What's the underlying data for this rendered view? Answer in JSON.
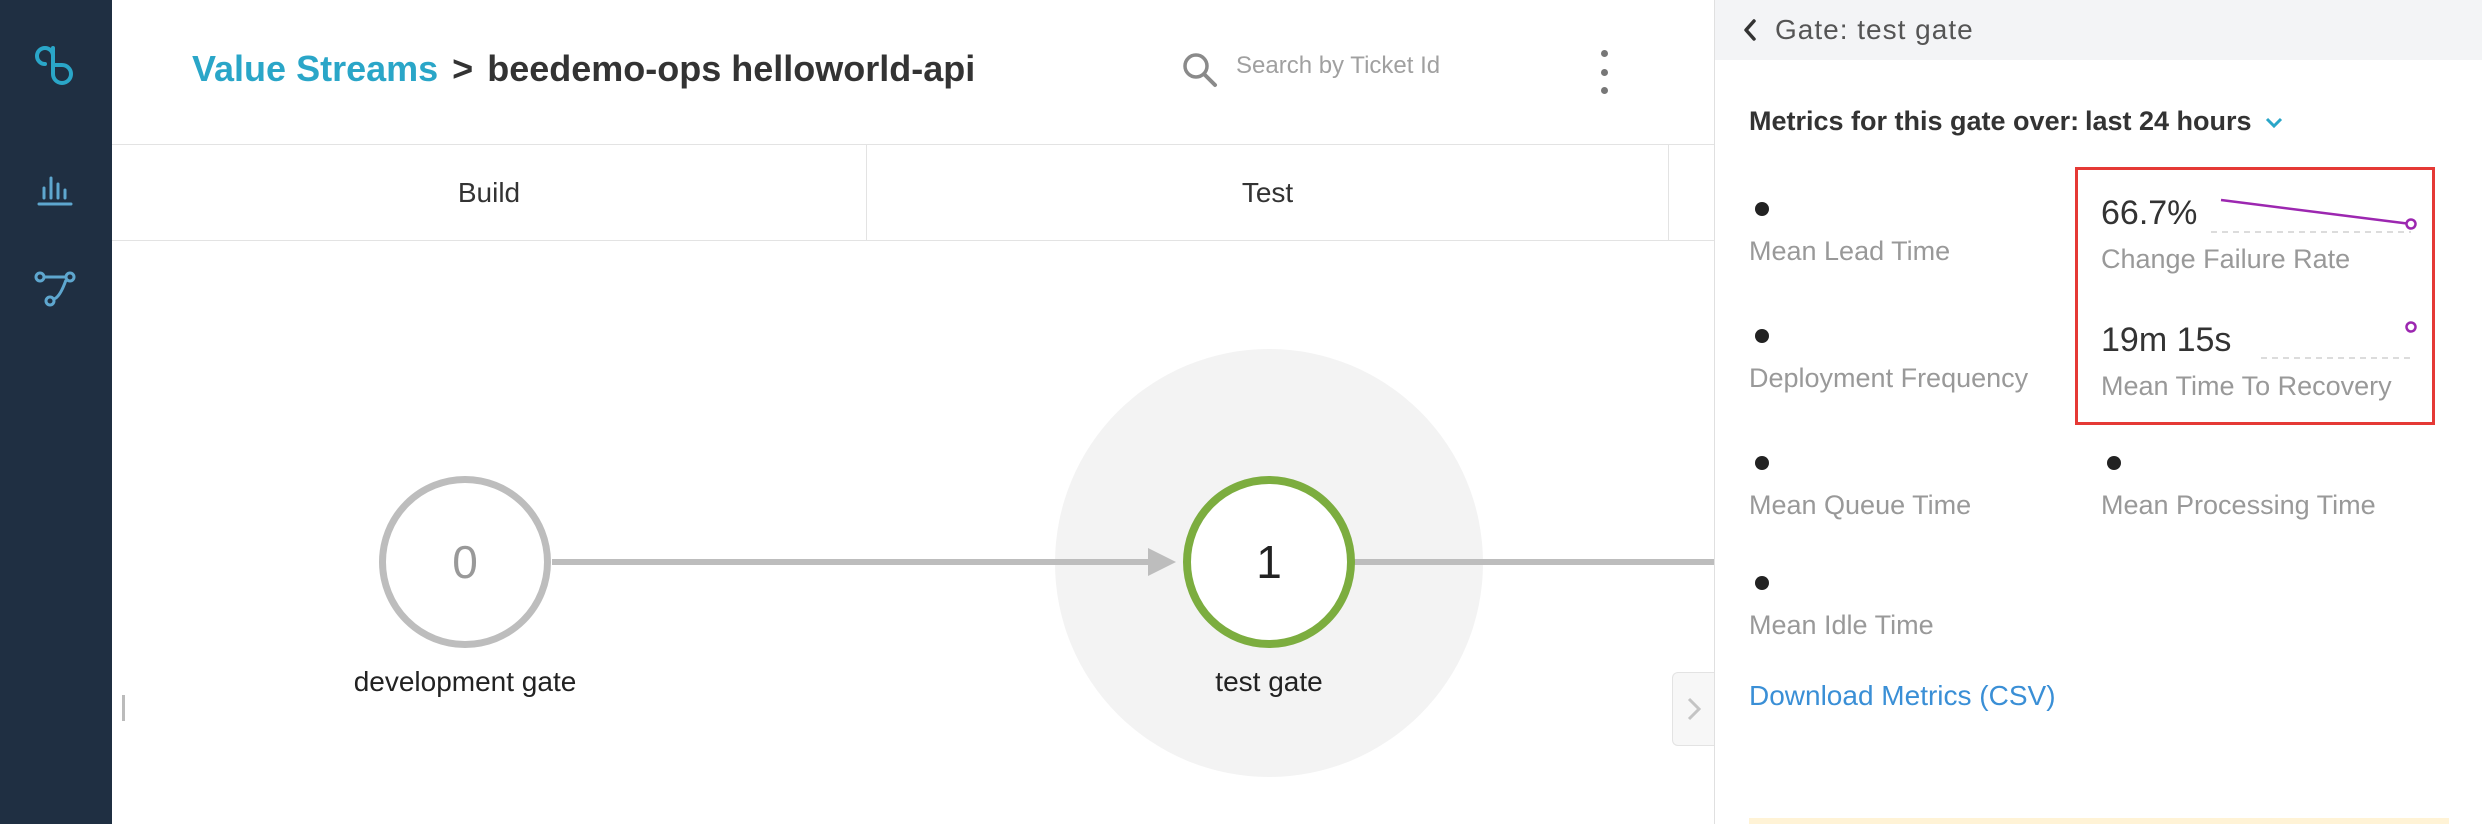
{
  "nav": {
    "items": [
      {
        "icon": "cloudbees-logo-icon"
      },
      {
        "icon": "bar-chart-icon"
      },
      {
        "icon": "value-stream-icon"
      }
    ]
  },
  "header": {
    "breadcrumb_root": "Value Streams",
    "breadcrumb_separator": ">",
    "breadcrumb_current": "beedemo-ops helloworld-api",
    "search_placeholder": "Search by Ticket Id"
  },
  "stages": [
    {
      "label": "Build"
    },
    {
      "label": "Test"
    }
  ],
  "gates": [
    {
      "count": "0",
      "label": "development gate",
      "status_color": "#bdbdbd"
    },
    {
      "count": "1",
      "label": "test gate",
      "status_color": "#7cad3f"
    }
  ],
  "panel": {
    "title": "Gate: test gate",
    "metrics_label": "Metrics for this gate over:",
    "time_range": "last 24 hours",
    "metrics": {
      "mean_lead_time": {
        "label": "Mean Lead Time"
      },
      "change_failure_rate": {
        "label": "Change Failure Rate",
        "value": "66.7%"
      },
      "deployment_frequency": {
        "label": "Deployment Frequency"
      },
      "mean_time_to_recovery": {
        "label": "Mean Time To Recovery",
        "value": "19m 15s"
      },
      "mean_queue_time": {
        "label": "Mean Queue Time"
      },
      "mean_processing_time": {
        "label": "Mean Processing Time"
      },
      "mean_idle_time": {
        "label": "Mean Idle Time"
      }
    },
    "download_label": "Download Metrics (CSV)"
  },
  "colors": {
    "rail": "#1f2f42",
    "accent": "#2aa6c8",
    "gate_active": "#7cad3f",
    "sparkline": "#9c27b0",
    "highlight_box": "#e53935",
    "link": "#3a8fd6"
  }
}
